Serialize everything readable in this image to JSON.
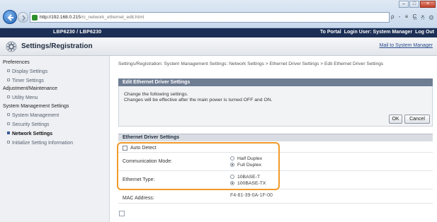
{
  "browser": {
    "url_host": "http://192.168.0.215",
    "url_path": "/rc_network_ethernet_edit.html",
    "search_glyph": "ρ - ≡ C ×",
    "window_buttons": [
      "–",
      "□",
      "×"
    ]
  },
  "header": {
    "device_name": "LBP6230 / LBP6230",
    "to_portal": "To Portal",
    "login_user": "Login User: System Manager",
    "log_out": "Log Out"
  },
  "title_bar": {
    "title": "Settings/Registration",
    "mail_link": "Mail to System Manager"
  },
  "sidebar": {
    "preferences": "Preferences",
    "display_settings": "Display Settings",
    "timer_settings": "Timer Settings",
    "adjustment": "Adjustment/Maintenance",
    "utility_menu": "Utility Menu",
    "system_management_settings": "System Management Settings",
    "system_management": "System Management",
    "security_settings": "Security Settings",
    "network_settings": "Network Settings",
    "initialize": "Initialize Setting Information"
  },
  "breadcrumb": "Settings/Registration: System Management Settings: Network Settings > Ethernet Driver Settings > Edit Ethernet Driver Settings",
  "panel": {
    "title": "Edit Ethernet Driver Settings",
    "line1": "Change the following settings.",
    "line2": "Changes will be effective after the main power is turned OFF and ON.",
    "ok_label": "OK",
    "cancel_label": "Cancel"
  },
  "section": {
    "title": "Ethernet Driver Settings",
    "auto_detect_label": "Auto Detect",
    "auto_detect_checked": false,
    "comm_mode_label": "Communication Mode:",
    "half_duplex": "Half Duplex",
    "full_duplex": "Full Duplex",
    "comm_mode_selected": "Full Duplex",
    "ethernet_type_label": "Ethernet Type:",
    "type_10": "10BASE-T",
    "type_100": "100BASE-TX",
    "ethernet_type_selected": "100BASE-TX",
    "mac_label": "MAC Address:",
    "mac_value": "F4-81-39-0A-1F-00"
  },
  "colors": {
    "header_bg": "#1c2f55",
    "panel_head": "#6f7d93",
    "highlight": "#f09a2a"
  }
}
